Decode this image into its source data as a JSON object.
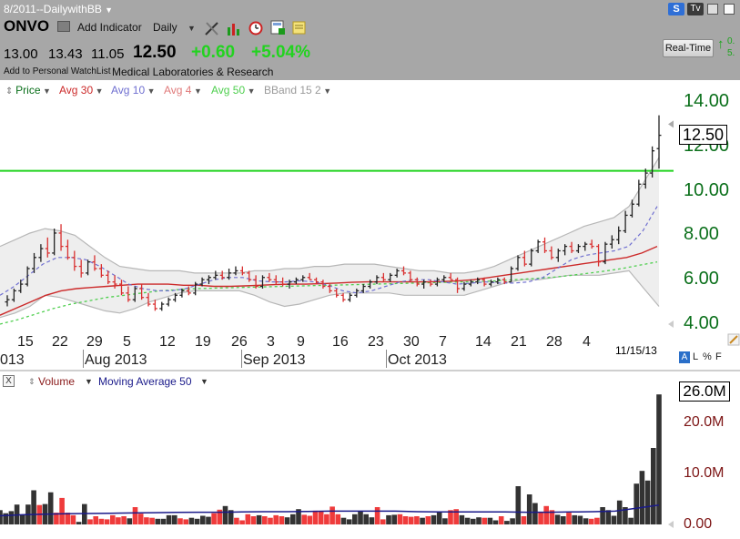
{
  "window": {
    "layout_name": "8/2011--DailywithBB",
    "symbol": "ONVO",
    "add_indicator": "Add Indicator",
    "period": "Daily",
    "add_watchlist": "Add to Personal WatchList",
    "company": "Medical Laboratories & Research",
    "realtime": "Real-Time",
    "right_partial_1": "0.",
    "right_partial_2": "5."
  },
  "quote": {
    "open": "13.00",
    "high": "13.43",
    "low": "11.05",
    "last": "12.50",
    "change": "+0.60",
    "change_pct": "+5.04%"
  },
  "indicators": [
    {
      "label": "Price",
      "color": "#0a6f1a"
    },
    {
      "label": "Avg 30",
      "color": "#cc2a2a"
    },
    {
      "label": "Avg 10",
      "color": "#6f6fd0"
    },
    {
      "label": "Avg 4",
      "color": "#e07a7a"
    },
    {
      "label": "Avg 50",
      "color": "#4fcf4f"
    },
    {
      "label": "BBand 15 2",
      "color": "#9a9a9a"
    }
  ],
  "volume_panel": {
    "close_glyph": "X",
    "volume_label": "Volume",
    "ma_label": "Moving Average 50",
    "volume_color": "#8a1a1a",
    "ma_color": "#1a1a8a"
  },
  "price_axis": {
    "ticks": [
      "14.00",
      "12.00",
      "10.00",
      "8.00",
      "6.00",
      "4.00"
    ],
    "last_label": "12.50"
  },
  "volume_axis": {
    "ticks": [
      "20.0M",
      "10.0M",
      "0.00"
    ],
    "last_label": "26.0M"
  },
  "x_axis": {
    "day_ticks": [
      "15",
      "22",
      "29",
      "5",
      "12",
      "19",
      "26",
      "3",
      "9",
      "16",
      "23",
      "30",
      "7",
      "14",
      "21",
      "28",
      "4"
    ],
    "month_labels": [
      "013",
      "Aug 2013",
      "Sep 2013",
      "Oct 2013"
    ],
    "date_readout": "11/15/13"
  },
  "scale_buttons": {
    "a": "A",
    "l": "L",
    "pct": "%",
    "f": "F"
  },
  "colors": {
    "up": "#222222",
    "down": "#d93030",
    "hline": "#22d31f",
    "band_fill": "#eeeeee"
  },
  "chart_data": {
    "type": "line",
    "title": "",
    "xlabel": "",
    "ylabel": "",
    "ylim": [
      3.9,
      14.5
    ],
    "hline": 10.9,
    "candles_ohlc": [
      [
        5.0,
        5.3,
        4.8,
        5.1
      ],
      [
        5.1,
        5.6,
        5.0,
        5.5
      ],
      [
        5.5,
        6.0,
        5.4,
        5.8
      ],
      [
        5.8,
        6.6,
        5.7,
        6.5
      ],
      [
        6.5,
        7.2,
        6.3,
        7.0
      ],
      [
        7.0,
        7.6,
        6.8,
        7.4
      ],
      [
        7.4,
        7.9,
        7.0,
        7.2
      ],
      [
        7.2,
        8.3,
        7.1,
        8.1
      ],
      [
        8.1,
        8.5,
        7.3,
        7.5
      ],
      [
        7.5,
        7.8,
        6.9,
        7.0
      ],
      [
        7.0,
        7.3,
        6.4,
        6.6
      ],
      [
        6.6,
        6.9,
        6.1,
        6.3
      ],
      [
        6.3,
        6.9,
        6.2,
        6.8
      ],
      [
        6.8,
        7.1,
        6.4,
        6.5
      ],
      [
        6.5,
        6.7,
        6.1,
        6.2
      ],
      [
        6.2,
        6.4,
        5.8,
        5.9
      ],
      [
        5.9,
        6.2,
        5.6,
        5.8
      ],
      [
        5.8,
        6.0,
        5.3,
        5.4
      ],
      [
        5.4,
        5.7,
        5.0,
        5.1
      ],
      [
        5.1,
        5.7,
        5.0,
        5.6
      ],
      [
        5.6,
        5.8,
        5.1,
        5.2
      ],
      [
        5.2,
        5.4,
        4.8,
        4.9
      ],
      [
        4.9,
        5.1,
        4.6,
        4.7
      ],
      [
        4.7,
        5.0,
        4.6,
        4.9
      ],
      [
        4.9,
        5.2,
        4.8,
        5.1
      ],
      [
        5.1,
        5.4,
        5.0,
        5.3
      ],
      [
        5.3,
        5.6,
        5.2,
        5.5
      ],
      [
        5.5,
        5.7,
        5.3,
        5.4
      ],
      [
        5.4,
        5.9,
        5.3,
        5.8
      ],
      [
        5.8,
        6.1,
        5.7,
        6.0
      ],
      [
        6.0,
        6.2,
        5.8,
        6.1
      ],
      [
        6.1,
        6.4,
        6.0,
        6.2
      ],
      [
        6.2,
        6.4,
        6.0,
        6.1
      ],
      [
        6.1,
        6.5,
        6.0,
        6.3
      ],
      [
        6.3,
        6.6,
        6.2,
        6.4
      ],
      [
        6.4,
        6.6,
        6.2,
        6.3
      ],
      [
        6.3,
        6.4,
        5.9,
        6.0
      ],
      [
        6.0,
        6.2,
        5.6,
        5.7
      ],
      [
        5.7,
        6.2,
        5.6,
        6.1
      ],
      [
        6.1,
        6.3,
        5.9,
        6.0
      ],
      [
        6.0,
        6.2,
        5.8,
        5.9
      ],
      [
        5.9,
        6.1,
        5.7,
        5.8
      ],
      [
        5.8,
        6.0,
        5.6,
        5.9
      ],
      [
        5.9,
        6.1,
        5.8,
        6.0
      ],
      [
        6.0,
        6.2,
        5.9,
        6.1
      ],
      [
        6.1,
        6.3,
        6.0,
        6.0
      ],
      [
        6.0,
        6.1,
        5.8,
        5.9
      ],
      [
        5.9,
        6.0,
        5.6,
        5.7
      ],
      [
        5.7,
        5.8,
        5.4,
        5.5
      ],
      [
        5.5,
        5.6,
        5.2,
        5.3
      ],
      [
        5.3,
        5.4,
        5.0,
        5.1
      ],
      [
        5.1,
        5.4,
        5.0,
        5.3
      ],
      [
        5.3,
        5.6,
        5.2,
        5.5
      ],
      [
        5.5,
        5.8,
        5.4,
        5.7
      ],
      [
        5.7,
        6.0,
        5.6,
        5.9
      ],
      [
        5.9,
        6.2,
        5.8,
        6.1
      ],
      [
        6.1,
        6.3,
        5.9,
        6.0
      ],
      [
        6.0,
        6.3,
        5.9,
        6.2
      ],
      [
        6.2,
        6.5,
        6.1,
        6.4
      ],
      [
        6.4,
        6.6,
        6.2,
        6.3
      ],
      [
        6.3,
        6.4,
        5.9,
        6.0
      ],
      [
        6.0,
        6.1,
        5.7,
        5.8
      ],
      [
        5.8,
        6.0,
        5.6,
        5.9
      ],
      [
        5.9,
        6.0,
        5.7,
        5.8
      ],
      [
        5.8,
        6.1,
        5.7,
        6.0
      ],
      [
        6.0,
        6.2,
        5.9,
        6.1
      ],
      [
        6.1,
        6.3,
        6.0,
        6.0
      ],
      [
        6.0,
        6.1,
        5.4,
        5.6
      ],
      [
        5.6,
        5.9,
        5.5,
        5.8
      ],
      [
        5.8,
        6.0,
        5.7,
        5.9
      ],
      [
        5.9,
        6.1,
        5.8,
        6.0
      ],
      [
        6.0,
        6.1,
        5.7,
        5.8
      ],
      [
        5.8,
        6.0,
        5.7,
        5.9
      ],
      [
        5.9,
        6.1,
        5.8,
        6.0
      ],
      [
        6.0,
        6.1,
        5.8,
        5.9
      ],
      [
        5.9,
        6.6,
        5.9,
        6.5
      ],
      [
        6.5,
        7.1,
        6.4,
        7.0
      ],
      [
        7.0,
        7.3,
        6.6,
        6.7
      ],
      [
        6.7,
        7.4,
        6.6,
        7.3
      ],
      [
        7.3,
        7.8,
        7.2,
        7.7
      ],
      [
        7.7,
        7.9,
        7.2,
        7.3
      ],
      [
        7.3,
        7.5,
        6.9,
        7.0
      ],
      [
        7.0,
        7.4,
        6.8,
        7.3
      ],
      [
        7.3,
        7.6,
        7.1,
        7.5
      ],
      [
        7.5,
        7.7,
        7.2,
        7.3
      ],
      [
        7.3,
        7.6,
        7.2,
        7.5
      ],
      [
        7.5,
        7.7,
        7.3,
        7.6
      ],
      [
        7.6,
        7.8,
        7.4,
        7.5
      ],
      [
        7.5,
        7.6,
        6.6,
        6.8
      ],
      [
        6.8,
        7.7,
        6.7,
        7.6
      ],
      [
        7.6,
        8.0,
        7.4,
        7.8
      ],
      [
        7.8,
        8.4,
        7.6,
        8.2
      ],
      [
        8.2,
        9.1,
        8.1,
        8.9
      ],
      [
        8.9,
        9.6,
        8.8,
        9.4
      ],
      [
        9.4,
        10.5,
        9.3,
        10.3
      ],
      [
        10.3,
        11.0,
        10.1,
        10.8
      ],
      [
        10.8,
        12.0,
        10.6,
        11.8
      ],
      [
        11.9,
        13.4,
        11.0,
        12.5
      ]
    ],
    "bollinger_upper": [
      7.5,
      7.8,
      8.1,
      8.3,
      8.2,
      8.0,
      7.5,
      7.0,
      6.6,
      6.5,
      6.4,
      6.4,
      6.4,
      6.3,
      6.3,
      6.3,
      6.3,
      6.4,
      6.4,
      6.5,
      6.5,
      6.6,
      6.6,
      6.7,
      6.7,
      6.7,
      6.6,
      6.5,
      6.4,
      6.4,
      6.3,
      6.3,
      6.4,
      6.6,
      6.9,
      7.2,
      7.5,
      7.8,
      8.1,
      8.4,
      8.6,
      8.8,
      9.3,
      10.4,
      11.5
    ],
    "bollinger_lower": [
      4.3,
      4.5,
      4.8,
      5.3,
      5.2,
      5.0,
      4.8,
      4.6,
      4.5,
      4.7,
      5.0,
      5.2,
      5.4,
      5.5,
      5.5,
      5.5,
      5.5,
      5.3,
      5.0,
      4.8,
      4.9,
      5.1,
      5.3,
      5.4,
      5.4,
      5.4,
      5.4,
      5.3,
      5.3,
      5.3,
      5.3,
      5.3,
      5.5,
      5.7,
      5.9,
      6.0,
      6.0,
      6.1,
      6.2,
      6.2,
      6.2,
      6.3,
      6.4,
      5.6,
      4.8
    ],
    "avg30": [
      4.4,
      4.7,
      5.0,
      5.3,
      5.5,
      5.6,
      5.65,
      5.7,
      5.75,
      5.8,
      5.8,
      5.8,
      5.75,
      5.75,
      5.7,
      5.7,
      5.72,
      5.75,
      5.78,
      5.8,
      5.8,
      5.82,
      5.85,
      5.88,
      5.9,
      5.9,
      5.9,
      5.9,
      5.9,
      5.92,
      5.95,
      6.0,
      6.1,
      6.2,
      6.3,
      6.4,
      6.5,
      6.6,
      6.7,
      6.8,
      6.9,
      7.0,
      7.2,
      7.5
    ],
    "avg50": [
      4.0,
      4.2,
      4.45,
      4.7,
      4.9,
      5.05,
      5.2,
      5.3,
      5.4,
      5.5,
      5.55,
      5.6,
      5.62,
      5.64,
      5.66,
      5.68,
      5.7,
      5.72,
      5.74,
      5.76,
      5.78,
      5.8,
      5.82,
      5.84,
      5.86,
      5.88,
      5.9,
      5.92,
      5.95,
      6.0,
      6.05,
      6.1,
      6.18,
      6.28,
      6.38,
      6.5,
      6.65,
      6.8
    ],
    "avg10": [
      5.3,
      5.7,
      6.2,
      6.7,
      7.0,
      7.0,
      6.9,
      6.6,
      6.2,
      5.8,
      5.6,
      5.5,
      5.5,
      5.6,
      5.8,
      6.0,
      6.1,
      6.1,
      5.95,
      5.9,
      5.9,
      5.95,
      5.9,
      5.75,
      5.5,
      5.4,
      5.5,
      5.7,
      5.9,
      6.0,
      6.0,
      5.9,
      5.8,
      5.85,
      5.9,
      5.85,
      5.85,
      5.9,
      6.1,
      6.5,
      6.9,
      7.1,
      7.2,
      7.3,
      7.5,
      8.2,
      9.3
    ],
    "volume_m": [
      2.8,
      2.2,
      2.6,
      3.9,
      1.9,
      3.9,
      6.7,
      3.8,
      4.0,
      6.3,
      2.3,
      5.2,
      2.3,
      1.8,
      0.5,
      4.0,
      1.0,
      1.6,
      1.1,
      1.0,
      1.8,
      1.4,
      1.6,
      1.2,
      3.4,
      2.1,
      1.4,
      1.3,
      1.1,
      1.1,
      1.8,
      1.8,
      1.2,
      1.0,
      1.3,
      1.1,
      1.7,
      1.5,
      2.2,
      2.9,
      3.6,
      2.8,
      1.3,
      0.8,
      2.0,
      1.6,
      1.8,
      1.6,
      1.3,
      1.8,
      1.6,
      1.4,
      2.0,
      3.0,
      1.9,
      1.7,
      2.7,
      2.5,
      2.0,
      3.5,
      2.0,
      1.3,
      1.0,
      2.0,
      2.5,
      2.0,
      1.4,
      3.4,
      1.0,
      1.8,
      1.9,
      2.0,
      1.6,
      1.5,
      1.6,
      1.3,
      1.6,
      1.8,
      2.5,
      1.2,
      2.8,
      3.0,
      1.8,
      1.3,
      1.1,
      1.4,
      1.3,
      1.3,
      0.8,
      1.6,
      0.7,
      1.2,
      7.5,
      1.6,
      5.9,
      4.2,
      2.5,
      3.6,
      2.8,
      1.9,
      1.6,
      2.3,
      1.8,
      1.7,
      1.2,
      1.1,
      1.3,
      3.4,
      2.8,
      1.7,
      4.7,
      3.4,
      1.3,
      8.0,
      10.5,
      8.6,
      15.0,
      25.5
    ],
    "volume_ma50": [
      1.7,
      1.9,
      2.0,
      2.1,
      2.15,
      2.2,
      2.25,
      2.3,
      2.35,
      2.4,
      2.4,
      2.45,
      2.5,
      2.5,
      2.55,
      2.6,
      2.6,
      2.6,
      2.6,
      2.5,
      2.45,
      2.45,
      2.45,
      2.45,
      2.4,
      2.4,
      2.45,
      2.5,
      2.6,
      3.2,
      3.8
    ]
  }
}
